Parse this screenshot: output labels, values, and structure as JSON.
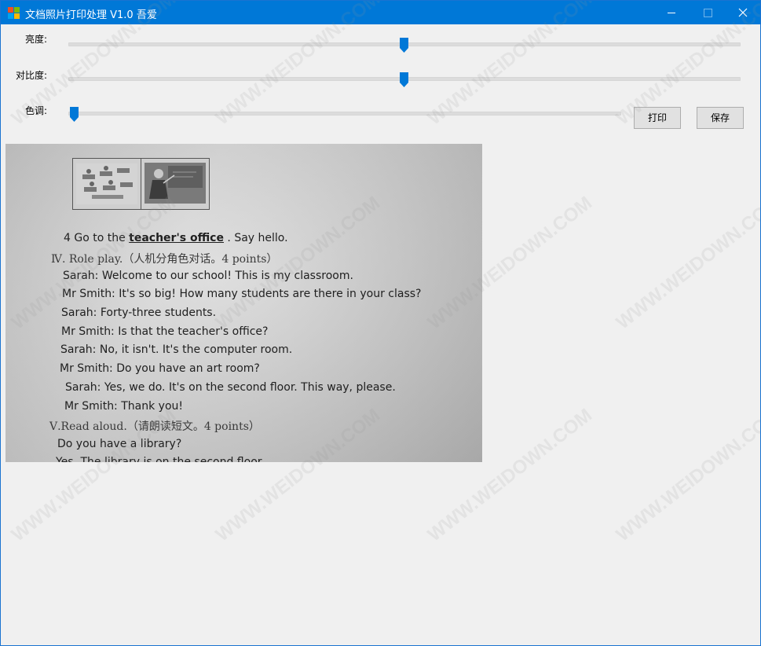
{
  "window": {
    "title": "文档照片打印处理 V1.0  吾爱"
  },
  "controls": {
    "brightness": {
      "label": "亮度:",
      "value": 0.5
    },
    "contrast": {
      "label": "对比度:",
      "value": 0.5
    },
    "hue": {
      "label": "色调:",
      "value": 0.0
    }
  },
  "buttons": {
    "print": "打印",
    "save": "保存"
  },
  "document": {
    "lines": [
      {
        "pre": "4 Go to the ",
        "u": "teacher's office",
        "post": " . Say hello."
      },
      {
        "pre": "Ⅳ. Role play.（人机分角色对话。4 points）",
        "u": "",
        "post": ""
      },
      {
        "pre": "Sarah: Welcome to our school! This is my classroom.",
        "u": "",
        "post": ""
      },
      {
        "pre": "Mr Smith: It's so big! How many students are there in your class?",
        "u": "",
        "post": ""
      },
      {
        "pre": "Sarah: Forty-three students.",
        "u": "",
        "post": ""
      },
      {
        "pre": "Mr Smith: Is that the teacher's office?",
        "u": "",
        "post": ""
      },
      {
        "pre": "Sarah: No, it isn't. It's the computer room.",
        "u": "",
        "post": ""
      },
      {
        "pre": "Mr Smith: Do you have an art room?",
        "u": "",
        "post": ""
      },
      {
        "pre": "Sarah: Yes, we do. It's on the second floor. This way, please.",
        "u": "",
        "post": ""
      },
      {
        "pre": "Mr Smith: Thank you!",
        "u": "",
        "post": ""
      },
      {
        "pre": "Ⅴ.Read aloud.（请朗读短文。4 points）",
        "u": "",
        "post": ""
      },
      {
        "pre": "Do you have a library?",
        "u": "",
        "post": ""
      },
      {
        "pre": "Yes. The library is on the second floor.",
        "u": "",
        "post": ""
      }
    ]
  },
  "watermark": "WWW.WEIDOWN.COM",
  "colors": {
    "titlebar": "#0078d7",
    "slider_thumb": "#0078d7"
  }
}
